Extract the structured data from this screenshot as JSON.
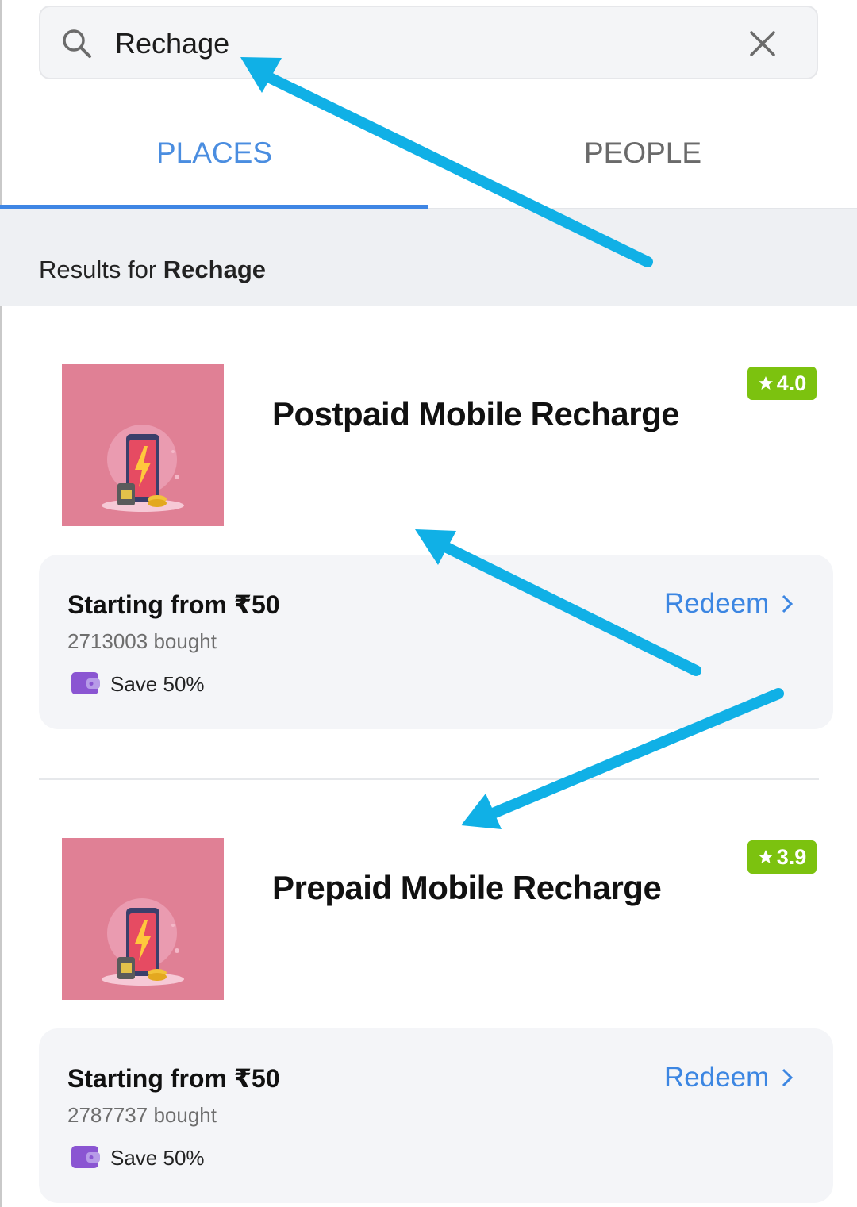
{
  "search": {
    "value": "Rechage",
    "icon": "search-icon",
    "clear_icon": "close-icon"
  },
  "tabs": [
    {
      "label": "PLACES",
      "active": true
    },
    {
      "label": "PEOPLE",
      "active": false
    }
  ],
  "results_header": {
    "prefix": "Results for",
    "query": "Rechage"
  },
  "results": [
    {
      "title": "Postpaid Mobile Recharge",
      "rating": "4.0",
      "price": "Starting from ₹50",
      "bought": "2713003 bought",
      "save": "Save 50%",
      "action": "Redeem"
    },
    {
      "title": "Prepaid Mobile Recharge",
      "rating": "3.9",
      "price": "Starting from ₹50",
      "bought": "2787737 bought",
      "save": "Save 50%",
      "action": "Redeem"
    }
  ],
  "colors": {
    "accent": "#3f86e4",
    "rating_badge": "#7cc20f",
    "thumbnail": "#e08095",
    "annotation_arrow": "#10b0e6"
  }
}
